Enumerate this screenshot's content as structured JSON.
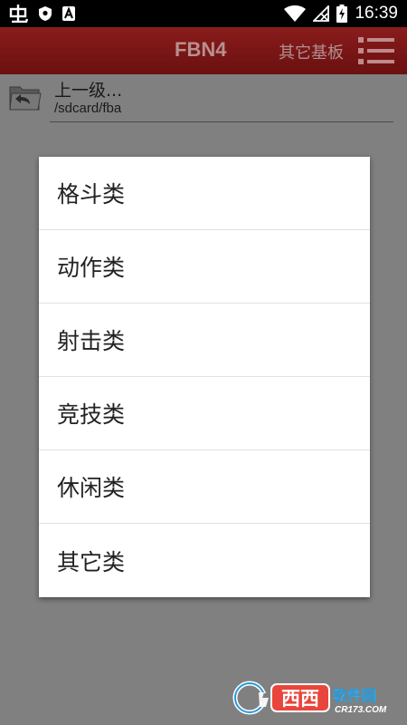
{
  "status_bar": {
    "time": "16:39",
    "notification_icons": [
      "bug-notification-icon",
      "shield-notification-icon",
      "app-a-notification-icon"
    ],
    "system_icons": [
      "wifi-icon",
      "no-signal-icon",
      "battery-charging-icon"
    ]
  },
  "title_bar": {
    "title": "FBN4",
    "other_boards_label": "其它基板",
    "menu_icon": "menu-list-icon",
    "background_color": "#7a1616"
  },
  "file_row": {
    "up_label": "上一级...",
    "path": "/sdcard/fba",
    "icon": "folder-up-icon"
  },
  "dialog": {
    "items": [
      {
        "label": "格斗类"
      },
      {
        "label": "动作类"
      },
      {
        "label": "射击类"
      },
      {
        "label": "竞技类"
      },
      {
        "label": "休闲类"
      },
      {
        "label": "其它类"
      }
    ]
  },
  "watermark": {
    "brand": "西西软件园",
    "site": "CR173.COM"
  }
}
